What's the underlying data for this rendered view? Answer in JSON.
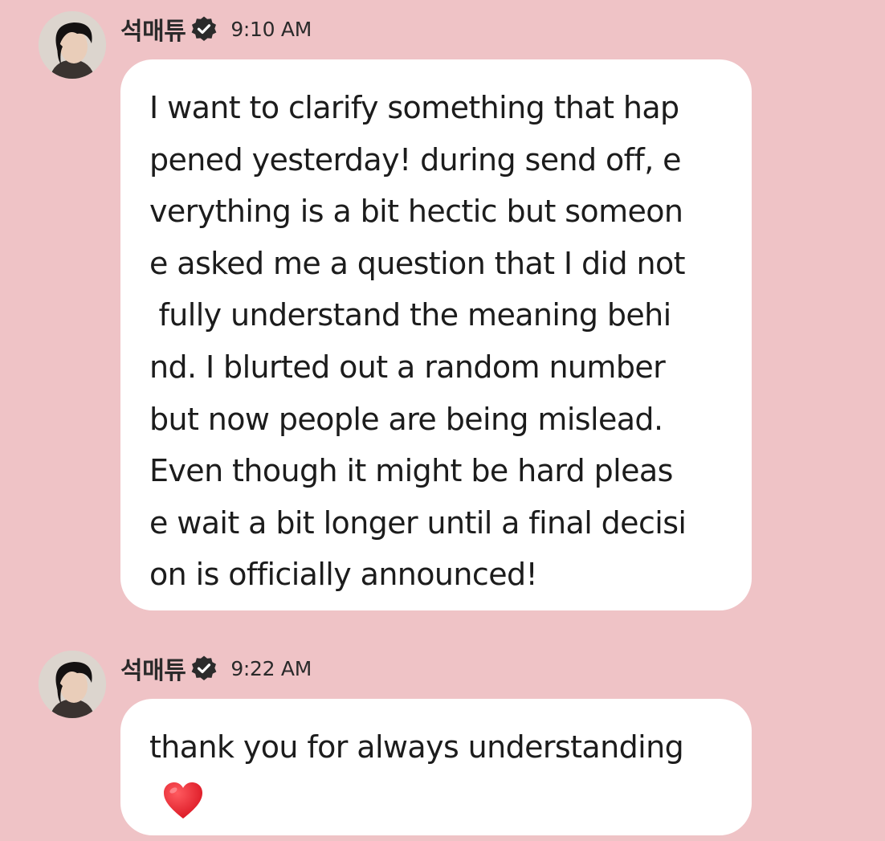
{
  "messages": [
    {
      "sender": "석매튜",
      "time": "9:10 AM",
      "lines": [
        "I want to clarify something that hap",
        "pened yesterday! during send off, e",
        "verything is a bit hectic but someon",
        "e asked me a question that I did not",
        " fully understand the meaning behi",
        "nd. I blurted out a random number",
        "but now people are being mislead.",
        "Even though it might be hard pleas",
        "e wait a bit longer until a final decisi",
        "on is officially announced!"
      ]
    },
    {
      "sender": "석매튜",
      "time": "9:22 AM",
      "lines": [
        "thank you for always understanding"
      ],
      "emoji": "red-heart"
    }
  ],
  "colors": {
    "background": "#efc3c6",
    "bubble": "#ffffff",
    "text": "#1c1c1c",
    "verified_badge": "#2b2b2b",
    "heart": "#e3202c"
  }
}
